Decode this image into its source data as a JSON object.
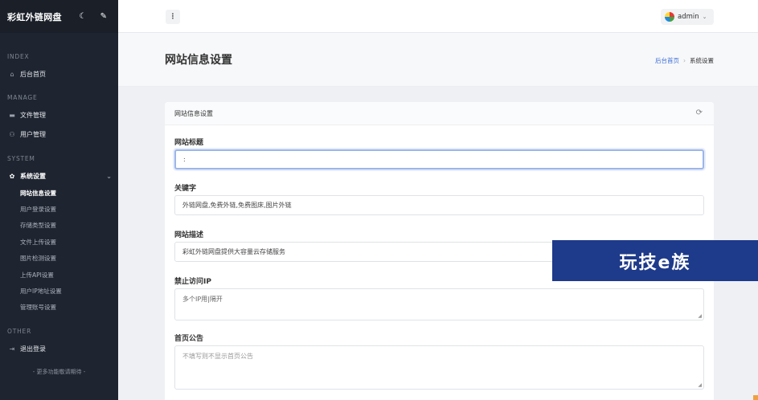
{
  "sidebar": {
    "brand": "彩虹外链网盘",
    "brand_icons": [
      "moon-icon",
      "pencil-icon"
    ],
    "sections": {
      "index": "INDEX",
      "manage": "MANAGE",
      "system": "SYSTEM",
      "other": "OTHER"
    },
    "items": {
      "home": "后台首页",
      "files": "文件管理",
      "users": "用户管理",
      "settings": "系统设置",
      "logout": "退出登录"
    },
    "sub_items": [
      "网站信息设置",
      "用户登录设置",
      "存储类型设置",
      "文件上传设置",
      "图片检测设置",
      "上传API设置",
      "用户IP地址设置",
      "管理账号设置"
    ],
    "footer": "- 更多功能敬请期待 -"
  },
  "topbar": {
    "user_name": "admin",
    "kebab": "⋮"
  },
  "page": {
    "title": "网站信息设置",
    "breadcrumb_home": "后台首页",
    "breadcrumb_sep": "›",
    "breadcrumb_current": "系统设置"
  },
  "card": {
    "title": "网站信息设置",
    "fields": {
      "site_title_label": "网站标题",
      "site_title_value": ":",
      "keywords_label": "关键字",
      "keywords_value": "外链网盘,免费外链,免费图床,图片外链",
      "description_label": "网站描述",
      "description_value": "彩虹外链网盘提供大容量云存储服务",
      "blocked_ip_label": "禁止访问IP",
      "blocked_ip_placeholder": "多个IP用|隔开",
      "announcement_label": "首页公告",
      "announcement_placeholder": "不填写则不显示首页公告"
    }
  },
  "watermark": "玩技e族",
  "colors": {
    "sidebar_bg": "#1f2530",
    "accent": "#3d6fd6",
    "watermark_bg": "#1e3a8a"
  }
}
